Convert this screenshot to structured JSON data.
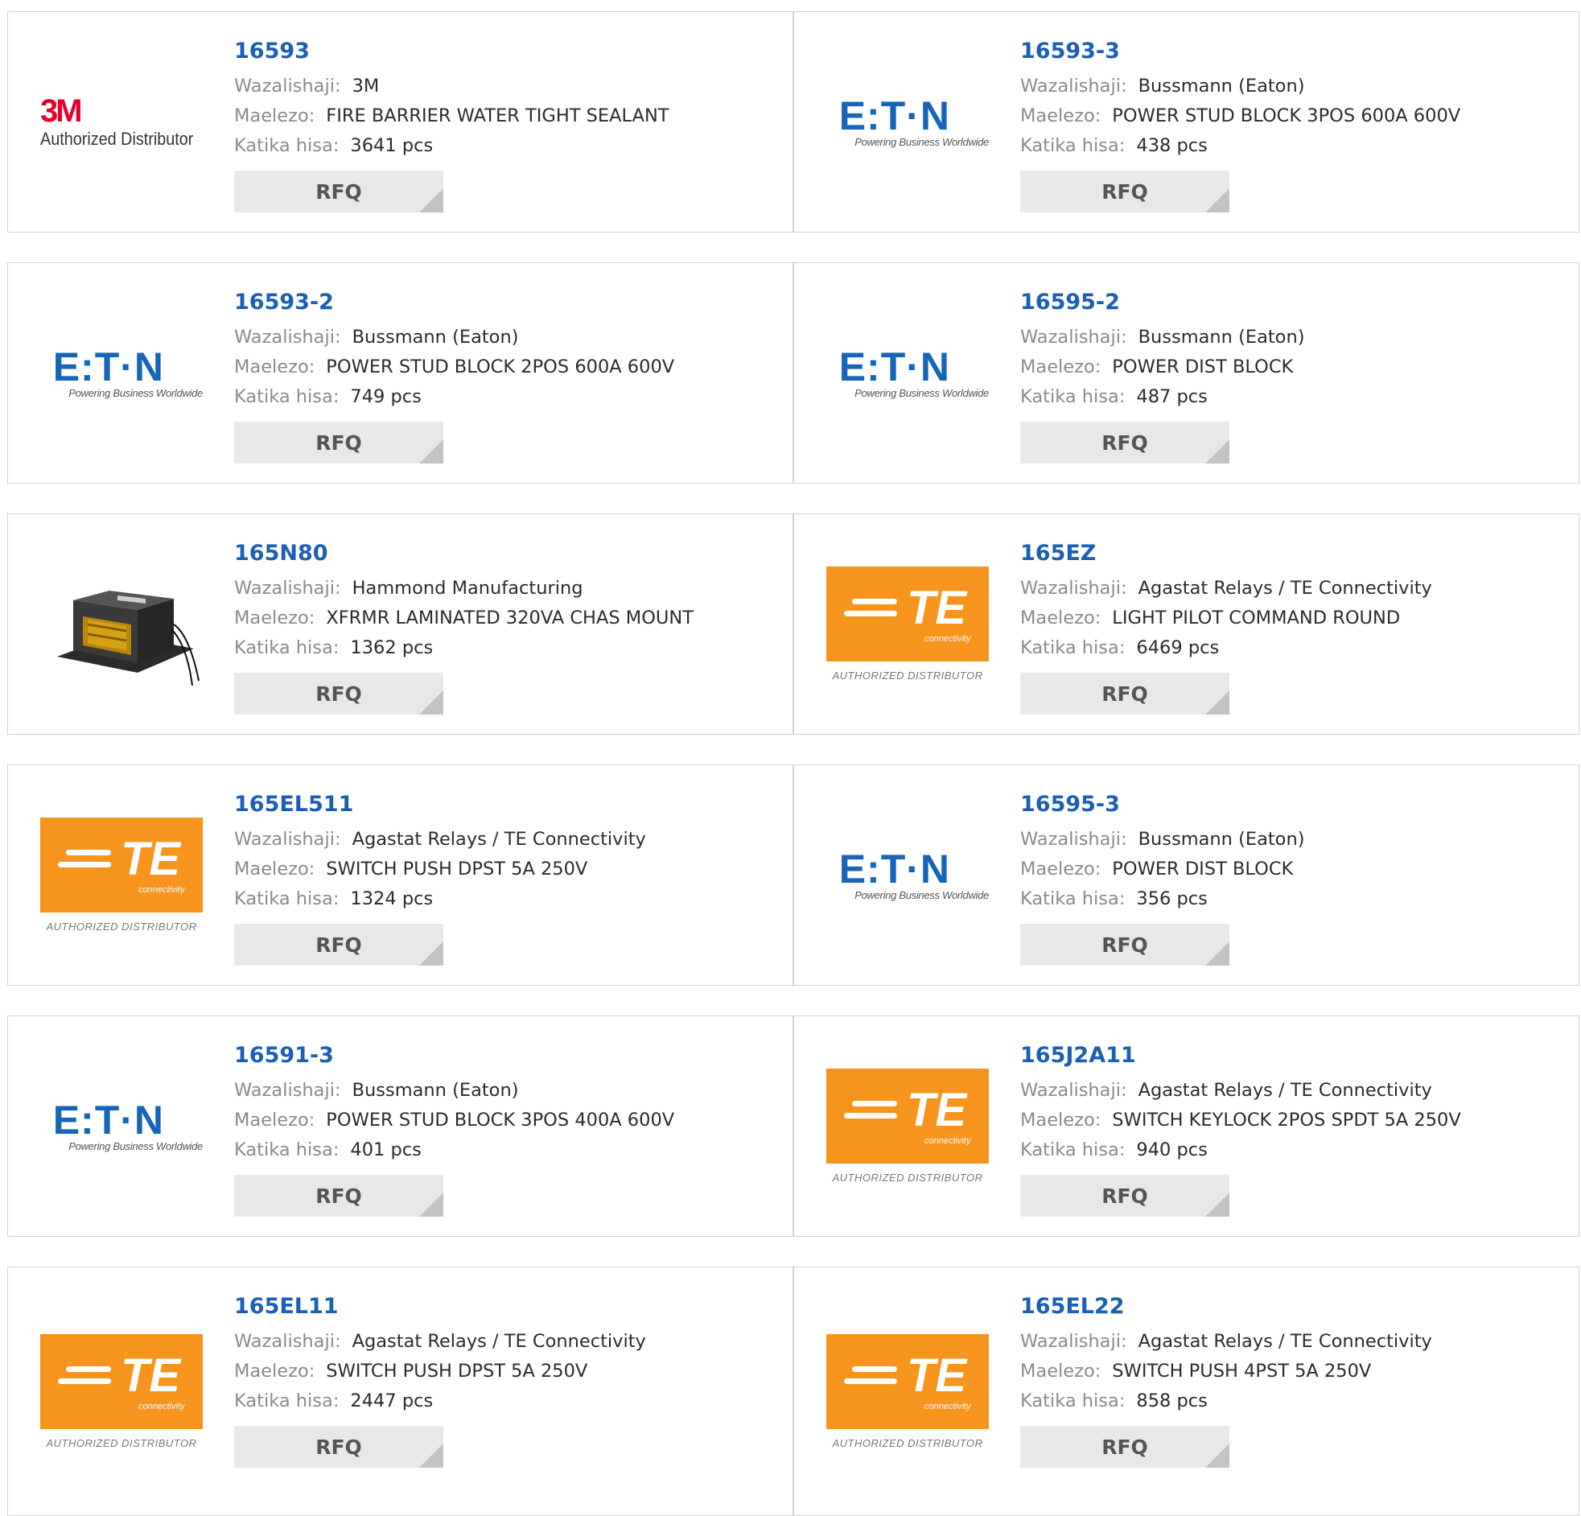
{
  "labels": {
    "manufacturer": "Wazalishaji:",
    "description": "Maelezo:",
    "stock": "Katika hisa:",
    "rfq": "RFQ"
  },
  "products": [
    {
      "part": "16593",
      "manufacturer": "3M",
      "description": "FIRE BARRIER WATER TIGHT SEALANT",
      "stock": "3641 pcs",
      "logo": "3m"
    },
    {
      "part": "16593-3",
      "manufacturer": "Bussmann (Eaton)",
      "description": "POWER STUD BLOCK 3POS 600A 600V",
      "stock": "438 pcs",
      "logo": "eaton"
    },
    {
      "part": "16593-2",
      "manufacturer": "Bussmann (Eaton)",
      "description": "POWER STUD BLOCK 2POS 600A 600V",
      "stock": "749 pcs",
      "logo": "eaton"
    },
    {
      "part": "16595-2",
      "manufacturer": "Bussmann (Eaton)",
      "description": "POWER DIST BLOCK",
      "stock": "487 pcs",
      "logo": "eaton"
    },
    {
      "part": "165N80",
      "manufacturer": "Hammond Manufacturing",
      "description": "XFRMR LAMINATED 320VA CHAS MOUNT",
      "stock": "1362 pcs",
      "logo": "photo"
    },
    {
      "part": "165EZ",
      "manufacturer": "Agastat Relays / TE Connectivity",
      "description": "LIGHT PILOT COMMAND ROUND",
      "stock": "6469 pcs",
      "logo": "te"
    },
    {
      "part": "165EL511",
      "manufacturer": "Agastat Relays / TE Connectivity",
      "description": "SWITCH PUSH DPST 5A 250V",
      "stock": "1324 pcs",
      "logo": "te"
    },
    {
      "part": "16595-3",
      "manufacturer": "Bussmann (Eaton)",
      "description": "POWER DIST BLOCK",
      "stock": "356 pcs",
      "logo": "eaton"
    },
    {
      "part": "16591-3",
      "manufacturer": "Bussmann (Eaton)",
      "description": "POWER STUD BLOCK 3POS 400A 600V",
      "stock": "401 pcs",
      "logo": "eaton"
    },
    {
      "part": "165J2A11",
      "manufacturer": "Agastat Relays / TE Connectivity",
      "description": "SWITCH KEYLOCK 2POS SPDT 5A 250V",
      "stock": "940 pcs",
      "logo": "te"
    },
    {
      "part": "165EL11",
      "manufacturer": "Agastat Relays / TE Connectivity",
      "description": "SWITCH PUSH DPST 5A 250V",
      "stock": "2447 pcs",
      "logo": "te"
    },
    {
      "part": "165EL22",
      "manufacturer": "Agastat Relays / TE Connectivity",
      "description": "SWITCH PUSH 4PST 5A 250V",
      "stock": "858 pcs",
      "logo": "te"
    }
  ],
  "logos": {
    "3m": {
      "mark": "3M",
      "text": "Authorized Distributor",
      "color": "#e4002b"
    },
    "eaton": {
      "word": "E:T·N",
      "tagline": "Powering Business Worldwide",
      "color": "#1565b8"
    },
    "te": {
      "mark": "TE",
      "sub": "connectivity",
      "text": "AUTHORIZED DISTRIBUTOR",
      "color": "#f7941d"
    }
  }
}
